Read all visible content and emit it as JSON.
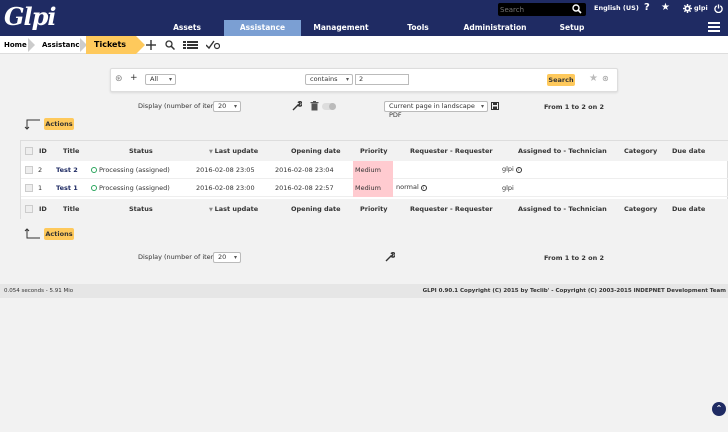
{
  "header": {
    "logo": "Glpi",
    "search_placeholder": "Search",
    "language": "English (US)",
    "user": "glpi",
    "help_icon": "?",
    "star_icon": "★"
  },
  "menu": {
    "items": [
      {
        "label": "Assets"
      },
      {
        "label": "Assistance"
      },
      {
        "label": "Management"
      },
      {
        "label": "Tools"
      },
      {
        "label": "Administration"
      },
      {
        "label": "Setup"
      }
    ]
  },
  "breadcrumb": {
    "home": "Home",
    "assistance": "Assistance",
    "tickets": "Tickets"
  },
  "search_panel": {
    "field": "All",
    "operator": "contains",
    "value": "2",
    "search_label": "Search"
  },
  "controls": {
    "display_label": "Display (number of items)",
    "display_value": "20",
    "export_value": "Current page in landscape PDF",
    "pagination": "From 1 to 2 on 2",
    "actions_label": "Actions"
  },
  "table": {
    "columns": [
      "ID",
      "Title",
      "Status",
      "Last update",
      "Opening date",
      "Priority",
      "Requester - Requester",
      "Assigned to - Technician",
      "Category",
      "Due date"
    ],
    "rows": [
      {
        "id": "2",
        "title": "Test 2",
        "status": "Processing (assigned)",
        "last_update": "2016-02-08 23:05",
        "opening_date": "2016-02-08 23:04",
        "priority": "Medium",
        "requester": "",
        "technician": "glpi",
        "category": "",
        "due_date": ""
      },
      {
        "id": "1",
        "title": "Test 1",
        "status": "Processing (assigned)",
        "last_update": "2016-02-08 23:00",
        "opening_date": "2016-02-08 22:57",
        "priority": "Medium",
        "requester": "normal",
        "technician": "glpi",
        "category": "",
        "due_date": ""
      }
    ]
  },
  "footer": {
    "timing": "0.054 seconds - 5.91 Mio",
    "copyright": "GLPI 0.90.1 Copyright (C) 2015 by Teclib' - Copyright (C) 2003-2015 INDEPNET Development Team"
  },
  "colors": {
    "header_bg": "#1f2b63",
    "active_menu": "#7b9fd3",
    "accent_yellow": "#fec95c",
    "priority_medium": "#ffcbd0"
  }
}
